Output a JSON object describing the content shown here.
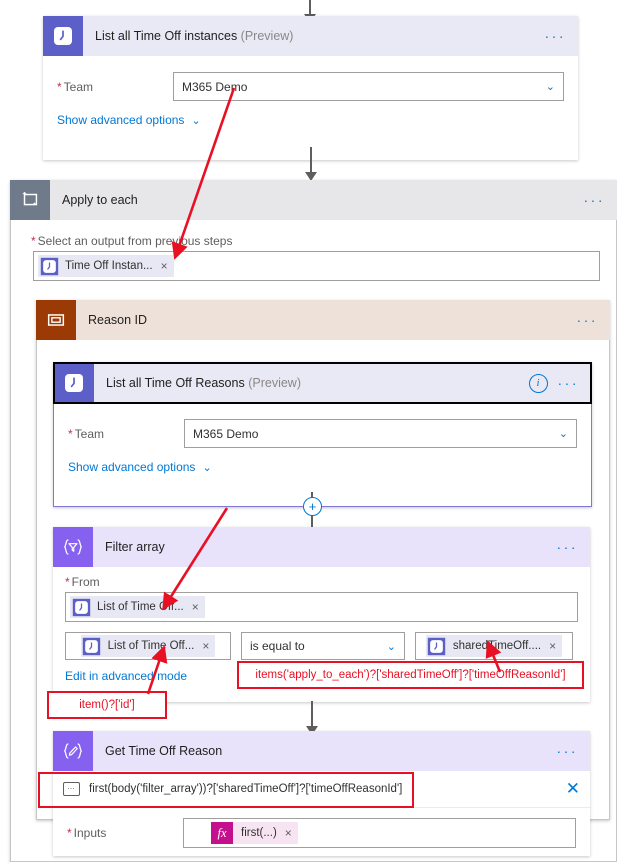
{
  "flow": {
    "steps": [
      {
        "id": "list-time-off-instances",
        "title": "List all Time Off instances",
        "suffix": "(Preview)",
        "icon": "clock-icon",
        "menu": "···",
        "fields": [
          {
            "label": "Team",
            "required": true,
            "value": "M365 Demo",
            "chevron": "⌄"
          }
        ],
        "advanced_label": "Show advanced options"
      },
      {
        "id": "apply-to-each",
        "title": "Apply to each",
        "icon": "loop-icon",
        "menu": "···",
        "select_label": "Select an output from previous steps",
        "select_required": true,
        "token": {
          "text": "Time Off Instan...",
          "icon": "clock-icon",
          "remove": "×"
        }
      },
      {
        "id": "reason-id",
        "title": "Reason ID",
        "icon": "variable-icon",
        "menu": "···"
      },
      {
        "id": "list-time-off-reasons",
        "title": "List all Time Off Reasons",
        "suffix": "(Preview)",
        "icon": "clock-icon",
        "info": "i",
        "menu": "···",
        "selected": true,
        "fields": [
          {
            "label": "Team",
            "required": true,
            "value": "M365 Demo",
            "chevron": "⌄"
          }
        ],
        "advanced_label": "Show advanced options"
      },
      {
        "id": "filter-array",
        "title": "Filter array",
        "icon": "filter-braces-icon",
        "menu": "···",
        "from_label": "From",
        "from_required": true,
        "from_token": {
          "text": "List of Time Off...",
          "icon": "clock-icon",
          "remove": "×"
        },
        "condition": {
          "left_token": {
            "text": "List of Time Off...",
            "icon": "clock-icon",
            "remove": "×"
          },
          "operator": "is equal to",
          "operator_chevron": "⌄",
          "right_token": {
            "text": "sharedTimeOff....",
            "icon": "clock-icon",
            "remove": "×"
          }
        },
        "advanced_mode_link": "Edit in advanced mode"
      },
      {
        "id": "get-time-off-reason",
        "title": "Get Time Off Reason",
        "icon": "compose-braces-icon",
        "menu": "···",
        "expression_row": {
          "icon": "comment-icon",
          "text": "first(body('filter_array'))?['sharedTimeOff']?['timeOffReasonId']",
          "close": "✕"
        },
        "fields": [
          {
            "label": "Inputs",
            "required": true,
            "token": {
              "text": "first(...)",
              "icon": "fx-icon",
              "remove": "×"
            }
          }
        ]
      }
    ],
    "add_button_label": "+"
  },
  "annotations": [
    {
      "id": "annot-items-expression",
      "text": "items('apply_to_each')?['sharedTimeOff']?['timeOffReasonId']"
    },
    {
      "id": "annot-item-id",
      "text": "item()?['id']"
    }
  ],
  "colors": {
    "connector_icon": "#5b5fc7",
    "scope_icon": "#6f7a8b",
    "variable_icon": "#9c3a06",
    "purple_icon": "#8661f0",
    "accent_blue": "#0078d4",
    "annotation_red": "#e81123",
    "fx_magenta": "#c4108d",
    "required_red": "#c4314b"
  }
}
